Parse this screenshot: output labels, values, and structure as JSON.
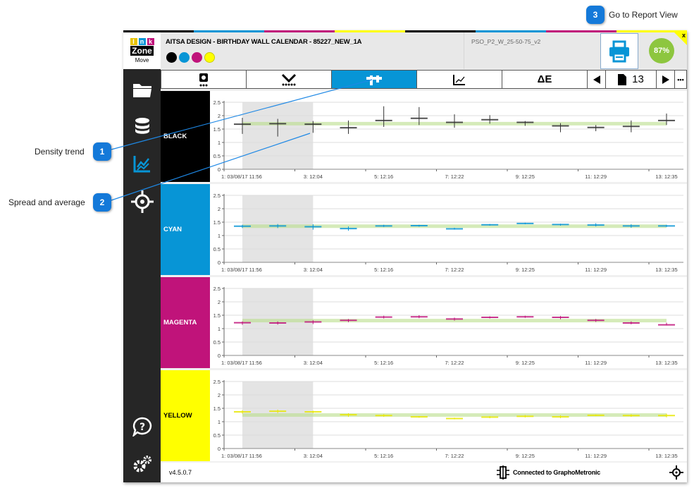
{
  "header": {
    "title": "AITSA DESIGN - BIRTHDAY WALL CALENDAR - 85227_NEW_1A",
    "profile": "PSO_P2_W_25-50-75_v2",
    "score": "87%",
    "close": "x",
    "ink_colors": [
      "#000000",
      "#0795d6",
      "#c0137a",
      "#ffff00"
    ],
    "logo": {
      "letters": [
        "I",
        "n",
        "k"
      ],
      "zone": "Zone",
      "move": "Move"
    }
  },
  "sidebar": {
    "items": [
      {
        "icon": "folder-icon"
      },
      {
        "icon": "database-icon"
      },
      {
        "icon": "trend-chart-icon",
        "active": true
      },
      {
        "icon": "target-icon"
      },
      {
        "icon": "help-icon"
      },
      {
        "icon": "settings-icon"
      }
    ]
  },
  "toolbar": {
    "page": "13",
    "active_tab": "density-trend",
    "more": "•••"
  },
  "footer": {
    "version": "v4.5.0.7",
    "status": "Connected to GraphoMetronic"
  },
  "callouts": [
    {
      "num": "1",
      "label": "Density trend"
    },
    {
      "num": "2",
      "label": "Spread and average"
    },
    {
      "num": "3",
      "label": "Go to Report View"
    }
  ],
  "chart_data": [
    {
      "type": "line",
      "title": "BLACK",
      "color": "#333333",
      "ylim": [
        0,
        2.5
      ],
      "yticks": [
        "0",
        "0.5",
        "1",
        "1.5",
        "2",
        "2.5"
      ],
      "xticks": [
        "1: 03/08/17 11:56",
        "3: 12:04",
        "5: 12:16",
        "7: 12:22",
        "9: 12:25",
        "11: 12:29",
        "13: 12:35"
      ],
      "highlight": [
        1,
        3
      ],
      "average": 1.7,
      "mean": [
        1.68,
        1.7,
        1.68,
        1.55,
        1.82,
        1.9,
        1.75,
        1.85,
        1.75,
        1.62,
        1.56,
        1.6,
        1.82
      ],
      "min": [
        1.32,
        1.22,
        1.36,
        1.32,
        1.58,
        1.65,
        1.55,
        1.7,
        1.62,
        1.38,
        1.42,
        1.38,
        1.65
      ],
      "max": [
        1.92,
        1.88,
        1.8,
        1.82,
        2.35,
        2.32,
        2.05,
        2.02,
        1.8,
        1.72,
        1.65,
        1.82,
        2.08
      ]
    },
    {
      "type": "line",
      "title": "CYAN",
      "color": "#0795d6",
      "ylim": [
        0,
        2.5
      ],
      "yticks": [
        "0",
        "0.5",
        "1",
        "1.5",
        "2",
        "2.5"
      ],
      "xticks": [
        "1: 03/08/17 11:56",
        "3: 12:04",
        "5: 12:16",
        "7: 12:22",
        "9: 12:25",
        "11: 12:29",
        "13: 12:35"
      ],
      "highlight": [
        1,
        3
      ],
      "average": 1.35,
      "mean": [
        1.35,
        1.36,
        1.33,
        1.26,
        1.36,
        1.37,
        1.25,
        1.4,
        1.45,
        1.41,
        1.39,
        1.36,
        1.36
      ],
      "min": [
        1.28,
        1.28,
        1.22,
        1.18,
        1.32,
        1.33,
        1.22,
        1.37,
        1.42,
        1.37,
        1.34,
        1.29,
        1.32
      ],
      "max": [
        1.4,
        1.43,
        1.42,
        1.34,
        1.4,
        1.4,
        1.29,
        1.43,
        1.48,
        1.44,
        1.46,
        1.42,
        1.4
      ]
    },
    {
      "type": "line",
      "title": "MAGENTA",
      "color": "#c0137a",
      "ylim": [
        0,
        2.5
      ],
      "yticks": [
        "0",
        "0.5",
        "1",
        "1.5",
        "2",
        "2.5"
      ],
      "xticks": [
        "1: 03/08/17 11:56",
        "3: 12:04",
        "5: 12:16",
        "7: 12:22",
        "9: 12:25",
        "11: 12:29",
        "13: 12:35"
      ],
      "highlight": [
        1,
        3
      ],
      "average": 1.3,
      "mean": [
        1.22,
        1.21,
        1.25,
        1.31,
        1.43,
        1.44,
        1.36,
        1.42,
        1.44,
        1.42,
        1.31,
        1.21,
        1.14
      ],
      "min": [
        1.14,
        1.15,
        1.17,
        1.24,
        1.38,
        1.39,
        1.3,
        1.38,
        1.4,
        1.35,
        1.25,
        1.16,
        1.12
      ],
      "max": [
        1.27,
        1.27,
        1.31,
        1.36,
        1.48,
        1.5,
        1.41,
        1.46,
        1.48,
        1.47,
        1.36,
        1.27,
        1.22
      ]
    },
    {
      "type": "line",
      "title": "YELLOW",
      "color": "#e8e800",
      "ylim": [
        0,
        2.5
      ],
      "yticks": [
        "0",
        "0.5",
        "1",
        "1.5",
        "2",
        "2.5"
      ],
      "xticks": [
        "1: 03/08/17 11:56",
        "3: 12:04",
        "5: 12:16",
        "7: 12:22",
        "9: 12:25",
        "11: 12:29",
        "13: 12:35"
      ],
      "highlight": [
        1,
        3
      ],
      "average": 1.25,
      "mean": [
        1.37,
        1.39,
        1.37,
        1.26,
        1.23,
        1.18,
        1.12,
        1.17,
        1.2,
        1.18,
        1.24,
        1.23,
        1.23
      ],
      "min": [
        1.3,
        1.32,
        1.32,
        1.18,
        1.18,
        1.15,
        1.09,
        1.13,
        1.16,
        1.13,
        1.21,
        1.18,
        1.16
      ],
      "max": [
        1.43,
        1.45,
        1.41,
        1.32,
        1.28,
        1.21,
        1.15,
        1.21,
        1.25,
        1.24,
        1.27,
        1.28,
        1.3
      ]
    }
  ]
}
